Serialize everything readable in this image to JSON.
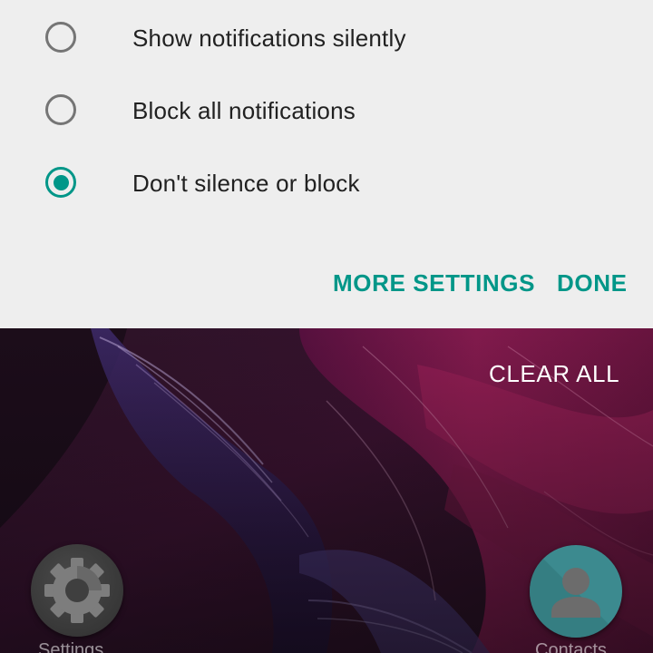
{
  "notification_options": [
    {
      "label": "Show notifications silently",
      "selected": false
    },
    {
      "label": "Block all notifications",
      "selected": false
    },
    {
      "label": "Don't silence or block",
      "selected": true
    }
  ],
  "actions": {
    "more_settings": "MORE SETTINGS",
    "done": "DONE"
  },
  "recents": {
    "clear_all": "CLEAR ALL",
    "apps": [
      {
        "name": "Settings",
        "icon": "gear-icon"
      },
      {
        "name": "Contacts",
        "icon": "person-icon"
      }
    ]
  },
  "colors": {
    "accent": "#009688",
    "panel_background": "#eeeeee",
    "radio_unchecked": "#757575",
    "text_primary": "#212121"
  }
}
